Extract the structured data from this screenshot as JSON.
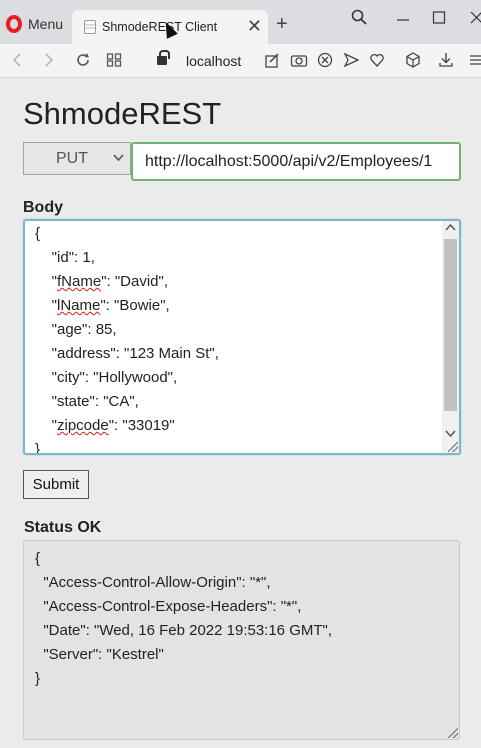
{
  "browser": {
    "menu_label": "Menu",
    "tab_title": "ShmodeREST Client",
    "close_glyph": "✕",
    "newtab_glyph": "+",
    "address": "localhost",
    "icons": [
      "back-icon",
      "forward-icon",
      "reload-icon",
      "tabs-grid-icon",
      "lock-icon",
      "share-icon",
      "camera-icon",
      "adblock-icon",
      "send-icon",
      "heart-icon",
      "cube-icon",
      "download-icon",
      "menu-lines-icon"
    ]
  },
  "app": {
    "title": "ShmodeREST",
    "method": "PUT",
    "url": "http://localhost:5000/api/v2/Employees/1",
    "body_label": "Body",
    "body_lines": [
      {
        "pre": "{",
        "key": "",
        "post": ""
      },
      {
        "pre": "    \"",
        "key": "id",
        "post": "\": 1,"
      },
      {
        "pre": "    \"",
        "key": "fName",
        "post": "\": \"David\","
      },
      {
        "pre": "    \"",
        "key": "lName",
        "post": "\": \"Bowie\","
      },
      {
        "pre": "    \"",
        "key": "age",
        "post": "\": 85,"
      },
      {
        "pre": "    \"",
        "key": "address",
        "post": "\": \"123 Main St\","
      },
      {
        "pre": "    \"",
        "key": "city",
        "post": "\": \"Hollywood\","
      },
      {
        "pre": "    \"",
        "key": "state",
        "post": "\": \"CA\","
      },
      {
        "pre": "    \"",
        "key": "zipcode",
        "post": "\": \"33019\""
      },
      {
        "pre": "}",
        "key": "",
        "post": ""
      }
    ],
    "spellcheck_keys": [
      "fName",
      "lName",
      "zipcode"
    ],
    "submit_label": "Submit",
    "status_label": "Status OK",
    "response_lines": [
      "{",
      "  \"Access-Control-Allow-Origin\": \"*\",",
      "  \"Access-Control-Expose-Headers\": \"*\",",
      "  \"Date\": \"Wed, 16 Feb 2022 19:53:16 GMT\",",
      "  \"Server\": \"Kestrel\"",
      "}"
    ]
  }
}
